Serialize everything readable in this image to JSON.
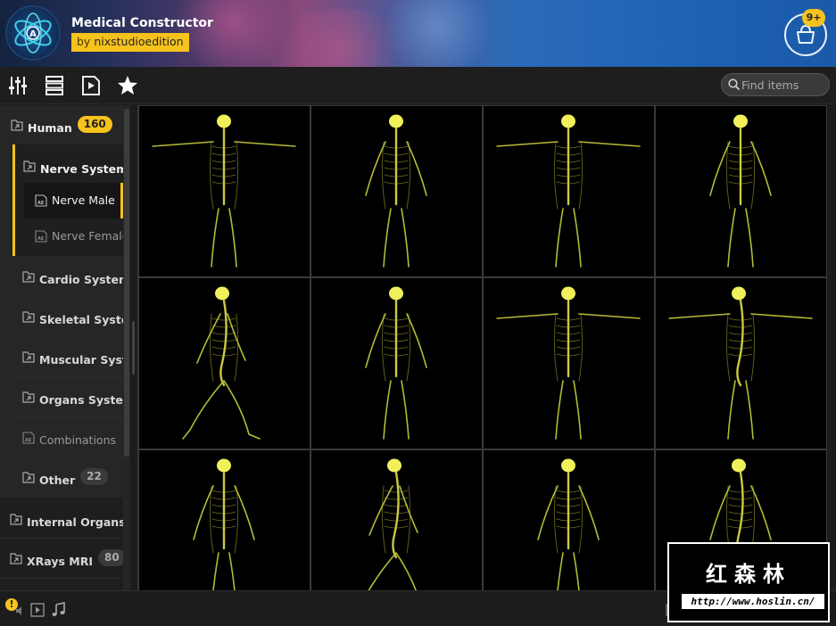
{
  "header": {
    "title": "Medical Constructor",
    "by_prefix": "by",
    "author": "nixstudioedition",
    "cart_badge": "9+",
    "cart_icon": "shopping-bag-icon"
  },
  "toolbar": {
    "icons": [
      "sliders-icon",
      "list-view-icon",
      "video-file-icon",
      "star-icon"
    ],
    "search_placeholder": "Find items"
  },
  "sidebar": {
    "human": {
      "label": "Human",
      "count": "160"
    },
    "nerve_system": {
      "label": "Nerve System"
    },
    "nerve_male": {
      "label": "Nerve Male"
    },
    "nerve_female": {
      "label": "Nerve Female"
    },
    "cardio": {
      "label": "Cardio System"
    },
    "skeletal": {
      "label": "Skeletal System"
    },
    "muscular": {
      "label": "Muscular System"
    },
    "organs": {
      "label": "Organs System"
    },
    "combinations": {
      "label": "Combinations"
    },
    "other": {
      "label": "Other",
      "count": "22"
    },
    "internal_organs": {
      "label": "Internal Organs"
    },
    "xrays": {
      "label": "XRays MRI",
      "count": "80"
    }
  },
  "grid": {
    "items": [
      {
        "pose": "tpose-front"
      },
      {
        "pose": "apose-front"
      },
      {
        "pose": "tpose-front"
      },
      {
        "pose": "apose-three-quarter"
      },
      {
        "pose": "walk-side"
      },
      {
        "pose": "apose-three-quarter"
      },
      {
        "pose": "tpose-front"
      },
      {
        "pose": "tpose-side"
      },
      {
        "pose": "apose-back"
      },
      {
        "pose": "walk-side"
      },
      {
        "pose": "apose-front"
      },
      {
        "pose": "apose-side"
      }
    ]
  },
  "footer": {
    "warning": "!",
    "icons": [
      "warning-icon",
      "play-icon",
      "music-note-icon"
    ]
  },
  "watermark": {
    "title": "红森林",
    "url": "http://www.hoslin.cn/"
  },
  "colors": {
    "accent": "#f6c21c",
    "nerve": "#c9cf3a",
    "brain": "#f1f05a"
  }
}
